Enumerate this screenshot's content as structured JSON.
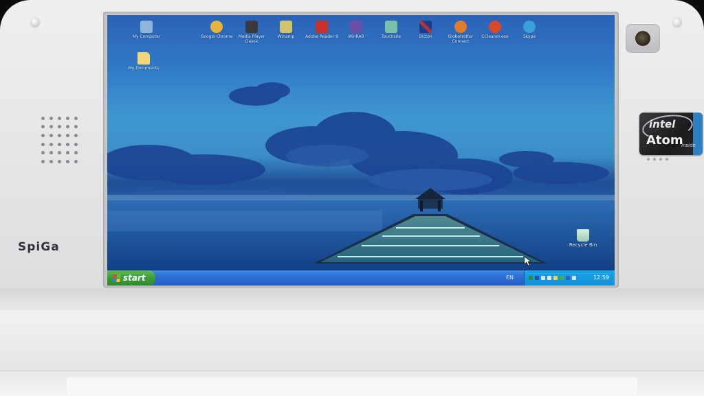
{
  "device": {
    "brand_label": "SpiGa",
    "badge": {
      "line1": "intel",
      "line2": "Atom",
      "line3": "inside"
    }
  },
  "desktop": {
    "top_icons": [
      {
        "label": "My Computer",
        "icon": "computer-icon",
        "color": "#8fb4da"
      },
      {
        "label": "Google Chrome",
        "icon": "chrome-icon",
        "color": "#e6b43a"
      },
      {
        "label": "Media Player Classic",
        "icon": "media-player-icon",
        "color": "#3a3a3a"
      },
      {
        "label": "Winamp",
        "icon": "winamp-icon",
        "color": "#d2c36a"
      },
      {
        "label": "Adobe Reader 9",
        "icon": "adobe-reader-icon",
        "color": "#c9322b"
      },
      {
        "label": "WinRAR",
        "icon": "winrar-icon",
        "color": "#6a4fa6"
      },
      {
        "label": "Touchsite",
        "icon": "touchsite-icon",
        "color": "#7ac0a8"
      },
      {
        "label": "Dicton",
        "icon": "dicton-icon",
        "color": "#b0323a"
      },
      {
        "label": "Globetrotter Connect",
        "icon": "globetrotter-icon",
        "color": "#e07b2a"
      },
      {
        "label": "CCleaner.exe",
        "icon": "ccleaner-icon",
        "color": "#d64a2a"
      },
      {
        "label": "Skype",
        "icon": "skype-icon",
        "color": "#3aa0d8"
      }
    ],
    "left_icons": [
      {
        "label": "My Documents",
        "icon": "folder-icon",
        "color": "#f0d878"
      }
    ],
    "recycle_bin": {
      "label": "Recycle Bin",
      "icon": "recycle-bin-icon"
    }
  },
  "taskbar": {
    "start_label": "start",
    "language": "EN",
    "clock": "12:59",
    "tray_icons": [
      "network-icon",
      "shield-icon",
      "tool-icon",
      "speaker-icon",
      "sync-icon",
      "security-icon",
      "bluetooth-icon",
      "volume-icon"
    ]
  }
}
